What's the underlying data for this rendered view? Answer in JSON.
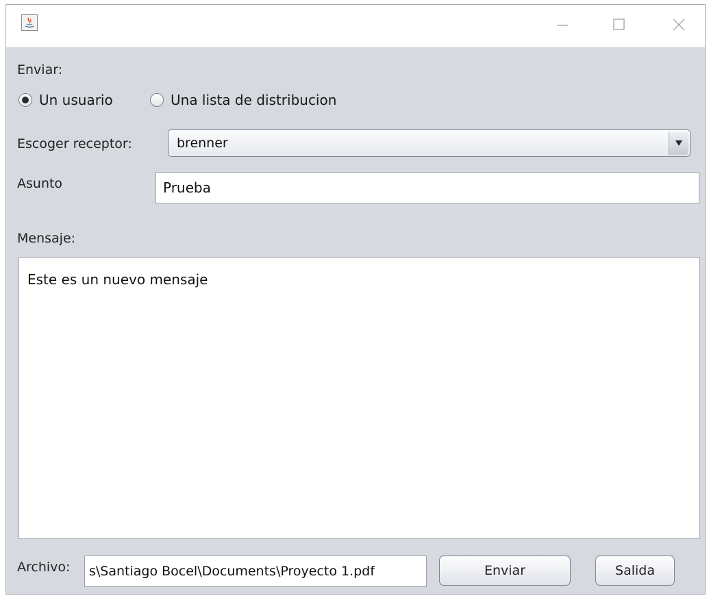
{
  "window": {
    "icons": {
      "app": "java-app-icon",
      "minimize": "minimize-icon",
      "maximize": "maximize-icon",
      "close": "close-icon"
    }
  },
  "send_section": {
    "label": "Enviar:",
    "options": [
      {
        "label": "Un usuario",
        "checked": true
      },
      {
        "label": "Una lista de distribucion",
        "checked": false
      }
    ]
  },
  "receiver": {
    "label": "Escoger receptor:",
    "selected": "brenner"
  },
  "subject": {
    "label": "Asunto",
    "value": "Prueba"
  },
  "message": {
    "label": "Mensaje:",
    "value": "Este es un nuevo mensaje"
  },
  "attachment": {
    "label": "Archivo:",
    "value": "s\\Santiago Bocel\\Documents\\Proyecto 1.pdf"
  },
  "buttons": {
    "send": "Enviar",
    "exit": "Salida"
  }
}
